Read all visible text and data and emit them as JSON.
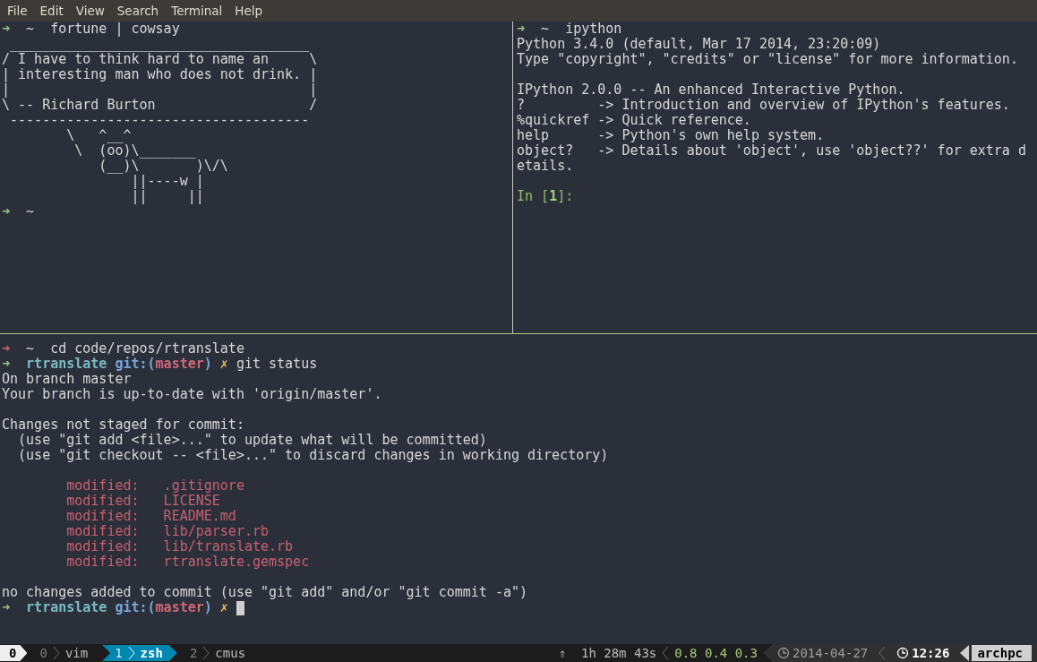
{
  "menu_bar": {
    "items": [
      "File",
      "Edit",
      "View",
      "Search",
      "Terminal",
      "Help"
    ]
  },
  "panes": [
    {
      "lines": [
        {
          "kind": "text",
          "segments": [
            {
              "kind": "arrow-ok",
              "text": "➜"
            },
            {
              "kind": "plain",
              "text": "  ~  fortune | cowsay"
            }
          ]
        },
        {
          "kind": "text",
          "segments": [
            {
              "kind": "plain",
              "text": " _____________________________________"
            }
          ]
        },
        {
          "kind": "text",
          "segments": [
            {
              "kind": "plain",
              "text": "/ I have to think hard to name an     \\"
            }
          ]
        },
        {
          "kind": "text",
          "segments": [
            {
              "kind": "plain",
              "text": "| interesting man who does not drink. |"
            }
          ]
        },
        {
          "kind": "text",
          "segments": [
            {
              "kind": "plain",
              "text": "|                                     |"
            }
          ]
        },
        {
          "kind": "text",
          "segments": [
            {
              "kind": "plain",
              "text": "\\ -- Richard Burton                   /"
            }
          ]
        },
        {
          "kind": "text",
          "segments": [
            {
              "kind": "plain",
              "text": " -------------------------------------"
            }
          ]
        },
        {
          "kind": "text",
          "segments": [
            {
              "kind": "plain",
              "text": "        \\   ^__^"
            }
          ]
        },
        {
          "kind": "text",
          "segments": [
            {
              "kind": "plain",
              "text": "         \\  (oo)\\_______"
            }
          ]
        },
        {
          "kind": "text",
          "segments": [
            {
              "kind": "plain",
              "text": "            (__)\\       )\\/\\"
            }
          ]
        },
        {
          "kind": "text",
          "segments": [
            {
              "kind": "plain",
              "text": "                ||----w |"
            }
          ]
        },
        {
          "kind": "text",
          "segments": [
            {
              "kind": "plain",
              "text": "                ||     ||"
            }
          ]
        },
        {
          "kind": "text",
          "segments": [
            {
              "kind": "arrow-ok",
              "text": "➜"
            },
            {
              "kind": "plain",
              "text": "  ~"
            }
          ]
        }
      ]
    },
    {
      "lines": [
        {
          "kind": "text",
          "segments": [
            {
              "kind": "arrow-ok",
              "text": "➜"
            },
            {
              "kind": "plain",
              "text": "  ~  ipython"
            }
          ]
        },
        {
          "kind": "text",
          "segments": [
            {
              "kind": "plain",
              "text": "Python 3.4.0 (default, Mar 17 2014, 23:20:09)"
            }
          ]
        },
        {
          "kind": "text",
          "segments": [
            {
              "kind": "plain",
              "text": "Type \"copyright\", \"credits\" or \"license\" for more information."
            }
          ]
        },
        {
          "kind": "blank"
        },
        {
          "kind": "text",
          "segments": [
            {
              "kind": "plain",
              "text": "IPython 2.0.0 -- An enhanced Interactive Python."
            }
          ]
        },
        {
          "kind": "text",
          "segments": [
            {
              "kind": "plain",
              "text": "?         -> Introduction and overview of IPython's features."
            }
          ]
        },
        {
          "kind": "text",
          "segments": [
            {
              "kind": "plain",
              "text": "%quickref -> Quick reference."
            }
          ]
        },
        {
          "kind": "text",
          "segments": [
            {
              "kind": "plain",
              "text": "help      -> Python's own help system."
            }
          ]
        },
        {
          "kind": "text",
          "segments": [
            {
              "kind": "plain",
              "text": "object?   -> Details about 'object', use 'object??' for extra d"
            }
          ]
        },
        {
          "kind": "text",
          "segments": [
            {
              "kind": "plain",
              "text": "etails."
            }
          ]
        },
        {
          "kind": "blank"
        },
        {
          "kind": "text",
          "segments": [
            {
              "kind": "input-prompt",
              "text": "In ["
            },
            {
              "kind": "input-number",
              "text": "1"
            },
            {
              "kind": "input-prompt",
              "text": "]:"
            }
          ]
        }
      ]
    },
    {
      "lines": [
        {
          "kind": "text",
          "segments": [
            {
              "kind": "arrow-fail",
              "text": "➜"
            },
            {
              "kind": "plain",
              "text": "  ~  cd code/repos/rtranslate"
            }
          ]
        },
        {
          "kind": "text",
          "segments": [
            {
              "kind": "arrow-ok",
              "text": "➜"
            },
            {
              "kind": "dir",
              "text": "  rtranslate"
            },
            {
              "kind": "git",
              "text": " git:("
            },
            {
              "kind": "branch",
              "text": "master"
            },
            {
              "kind": "git",
              "text": ")"
            },
            {
              "kind": "dirty",
              "text": " ✗"
            },
            {
              "kind": "plain",
              "text": " git status"
            }
          ]
        },
        {
          "kind": "text",
          "segments": [
            {
              "kind": "plain",
              "text": "On branch master"
            }
          ]
        },
        {
          "kind": "text",
          "segments": [
            {
              "kind": "plain",
              "text": "Your branch is up-to-date with 'origin/master'."
            }
          ]
        },
        {
          "kind": "blank"
        },
        {
          "kind": "text",
          "segments": [
            {
              "kind": "plain",
              "text": "Changes not staged for commit:"
            }
          ]
        },
        {
          "kind": "text",
          "segments": [
            {
              "kind": "plain",
              "text": "  (use \"git add <file>...\" to update what will be committed)"
            }
          ]
        },
        {
          "kind": "text",
          "segments": [
            {
              "kind": "plain",
              "text": "  (use \"git checkout -- <file>...\" to discard changes in working directory)"
            }
          ]
        },
        {
          "kind": "blank"
        },
        {
          "kind": "text",
          "segments": [
            {
              "kind": "modified",
              "text": "        modified:   .gitignore"
            }
          ]
        },
        {
          "kind": "text",
          "segments": [
            {
              "kind": "modified",
              "text": "        modified:   LICENSE"
            }
          ]
        },
        {
          "kind": "text",
          "segments": [
            {
              "kind": "modified",
              "text": "        modified:   README.md"
            }
          ]
        },
        {
          "kind": "text",
          "segments": [
            {
              "kind": "modified",
              "text": "        modified:   lib/parser.rb"
            }
          ]
        },
        {
          "kind": "text",
          "segments": [
            {
              "kind": "modified",
              "text": "        modified:   lib/translate.rb"
            }
          ]
        },
        {
          "kind": "text",
          "segments": [
            {
              "kind": "modified",
              "text": "        modified:   rtranslate.gemspec"
            }
          ]
        },
        {
          "kind": "blank"
        },
        {
          "kind": "text",
          "segments": [
            {
              "kind": "plain",
              "text": "no changes added to commit (use \"git add\" and/or \"git commit -a\")"
            }
          ]
        },
        {
          "kind": "text",
          "cursor": true,
          "segments": [
            {
              "kind": "arrow-ok",
              "text": "➜"
            },
            {
              "kind": "dir",
              "text": "  rtranslate"
            },
            {
              "kind": "git",
              "text": " git:("
            },
            {
              "kind": "branch",
              "text": "master"
            },
            {
              "kind": "git",
              "text": ")"
            },
            {
              "kind": "dirty",
              "text": " ✗"
            }
          ]
        }
      ]
    }
  ],
  "status_bar": {
    "session": "0",
    "windows": [
      {
        "index": "0",
        "name": "vim",
        "selected": false
      },
      {
        "index": "1",
        "name": "zsh",
        "selected": true
      },
      {
        "index": "2",
        "name": "cmus",
        "selected": false
      }
    ],
    "uptime": "⇑  1h 28m 43s",
    "load": "0.8 0.4 0.3",
    "date": "2014-04-27",
    "time": "12:26",
    "host": "archpc"
  }
}
